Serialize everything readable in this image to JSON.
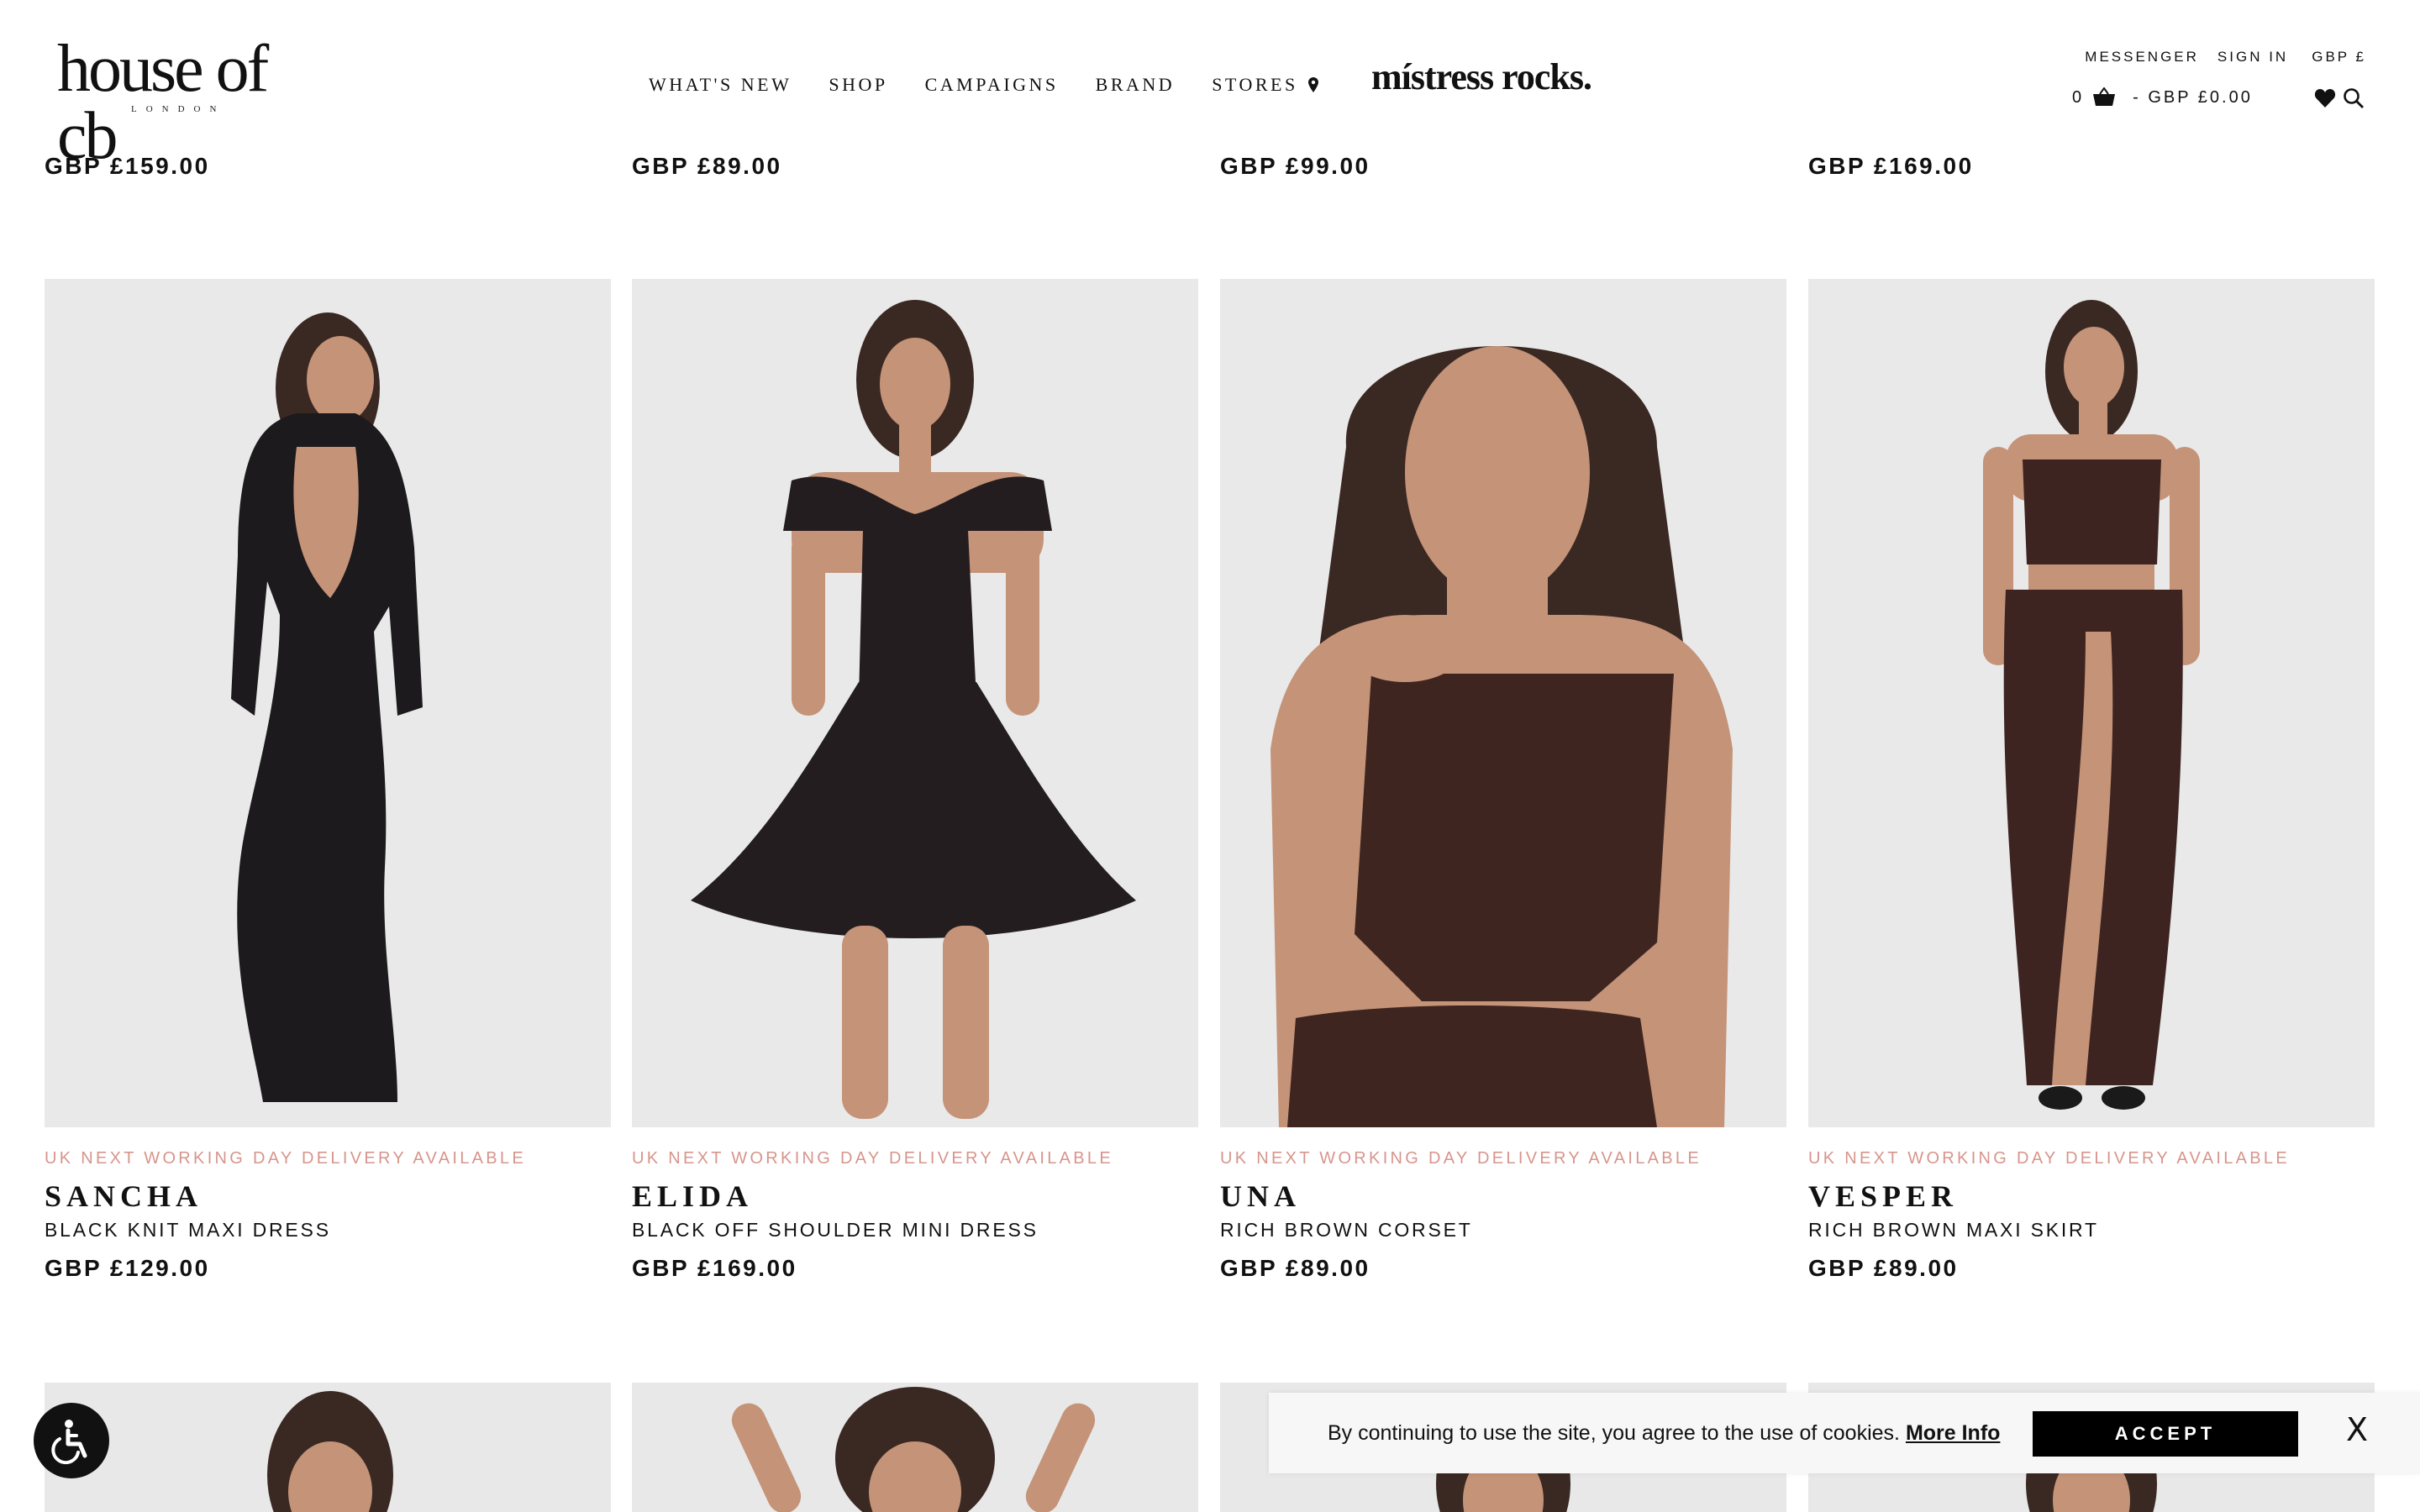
{
  "header": {
    "logo_main": "house of cb",
    "logo_sub": "LONDON",
    "nav": [
      "WHAT'S NEW",
      "SHOP",
      "CAMPAIGNS",
      "BRAND",
      "STORES"
    ],
    "campaign_logo": "místress rocks.",
    "util": {
      "messenger": "MESSENGER",
      "sign_in": "SIGN IN",
      "currency": "GBP £",
      "cart_count": "0",
      "cart_total": "- GBP £0.00"
    },
    "icons": [
      "map-pin-icon",
      "basket-icon",
      "heart-icon",
      "search-icon"
    ]
  },
  "top_prices": [
    "GBP £159.00",
    "GBP £89.00",
    "GBP £99.00",
    "GBP £169.00"
  ],
  "products": [
    {
      "delivery": "UK NEXT WORKING DAY DELIVERY AVAILABLE",
      "name": "SANCHA",
      "desc": "BLACK KNIT MAXI DRESS",
      "price": "GBP £129.00",
      "garment_color": "#1c1a1c"
    },
    {
      "delivery": "UK NEXT WORKING DAY DELIVERY AVAILABLE",
      "name": "ELIDA",
      "desc": "BLACK OFF SHOULDER MINI DRESS",
      "price": "GBP £169.00",
      "garment_color": "#231d1f"
    },
    {
      "delivery": "UK NEXT WORKING DAY DELIVERY AVAILABLE",
      "name": "UNA",
      "desc": "RICH BROWN CORSET",
      "price": "GBP £89.00",
      "garment_color": "#3f2520"
    },
    {
      "delivery": "UK NEXT WORKING DAY DELIVERY AVAILABLE",
      "name": "VESPER",
      "desc": "RICH BROWN MAXI SKIRT",
      "price": "GBP £89.00",
      "garment_color": "#3d2421"
    }
  ],
  "cookie": {
    "text": "By continuing to use the site, you agree to the use of cookies.",
    "link": "More Info",
    "accept": "ACCEPT",
    "close": "X"
  },
  "colors": {
    "delivery_text": "#d7958c",
    "image_bg": "#e9e9ea",
    "accept_bg": "#000000",
    "skin": "#c49378",
    "hair": "#3a2822"
  }
}
